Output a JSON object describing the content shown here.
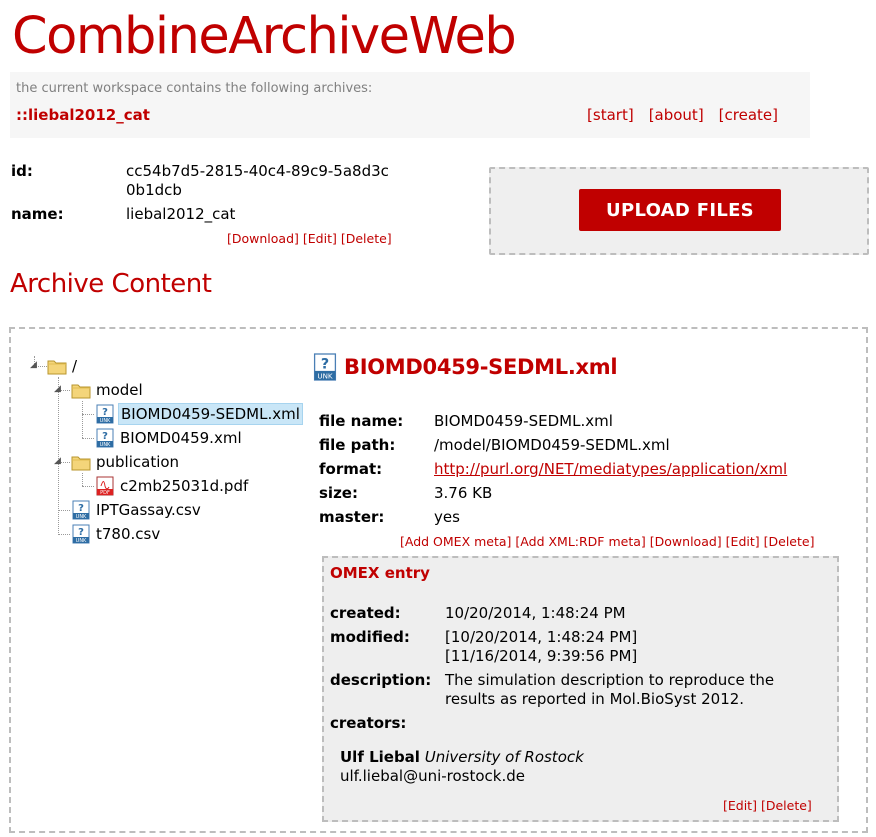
{
  "app": {
    "title": "CombineArchiveWeb"
  },
  "workspace": {
    "caption": "the current workspace contains the following archives:",
    "archive_link": "::liebal2012_cat"
  },
  "nav": {
    "start": "[start]",
    "about": "[about]",
    "create": "[create]"
  },
  "archive": {
    "id_label": "id:",
    "id_line1": "cc54b7d5-2815-40c4-89c9-5a8d3c",
    "id_line2": "0b1dcb",
    "name_label": "name:",
    "name_value": "liebal2012_cat",
    "actions": {
      "download": "[Download]",
      "edit": "[Edit]",
      "delete": "[Delete]"
    }
  },
  "upload": {
    "button_label": "UPLOAD FILES"
  },
  "content": {
    "section_title": "Archive Content",
    "tree": {
      "root": "/",
      "model_folder": "model",
      "sedml_file": "BIOMD0459-SEDML.xml",
      "xml_file": "BIOMD0459.xml",
      "publication_folder": "publication",
      "pdf_file": "c2mb25031d.pdf",
      "csv1": "IPTGassay.csv",
      "csv2": "t780.csv"
    },
    "file": {
      "title": "BIOMD0459-SEDML.xml",
      "name_label": "file name:",
      "name_value": "BIOMD0459-SEDML.xml",
      "path_label": "file path:",
      "path_value": "/model/BIOMD0459-SEDML.xml",
      "format_label": "format:",
      "format_value": "http://purl.org/NET/mediatypes/application/xml",
      "size_label": "size:",
      "size_value": "3.76 KB",
      "master_label": "master:",
      "master_value": "yes",
      "actions": {
        "add_omex": "[Add OMEX meta]",
        "add_rdf": "[Add XML:RDF meta]",
        "download": "[Download]",
        "edit": "[Edit]",
        "delete": "[Delete]"
      }
    },
    "omex": {
      "title": "OMEX entry",
      "created_label": "created:",
      "created_value": "10/20/2014, 1:48:24 PM",
      "modified_label": "modified:",
      "modified_value1": "[10/20/2014, 1:48:24 PM]",
      "modified_value2": "[11/16/2014, 9:39:56 PM]",
      "description_label": "description:",
      "description_line1": "The simulation description to reproduce the",
      "description_line2": "results as reported in Mol.BioSyst 2012.",
      "creators_label": "creators:",
      "creator_name": "Ulf Liebal",
      "creator_org": "University of Rostock",
      "creator_email": "ulf.liebal@uni-rostock.de",
      "actions": {
        "edit": "[Edit]",
        "delete": "[Delete]"
      }
    }
  },
  "icons": {
    "folder": "folder-icon",
    "unknown_file": "unknown-file-icon",
    "pdf_file": "pdf-file-icon"
  },
  "colors": {
    "accent": "#c00000",
    "selection": "#c9e6f7",
    "panel": "#eeeeee"
  }
}
